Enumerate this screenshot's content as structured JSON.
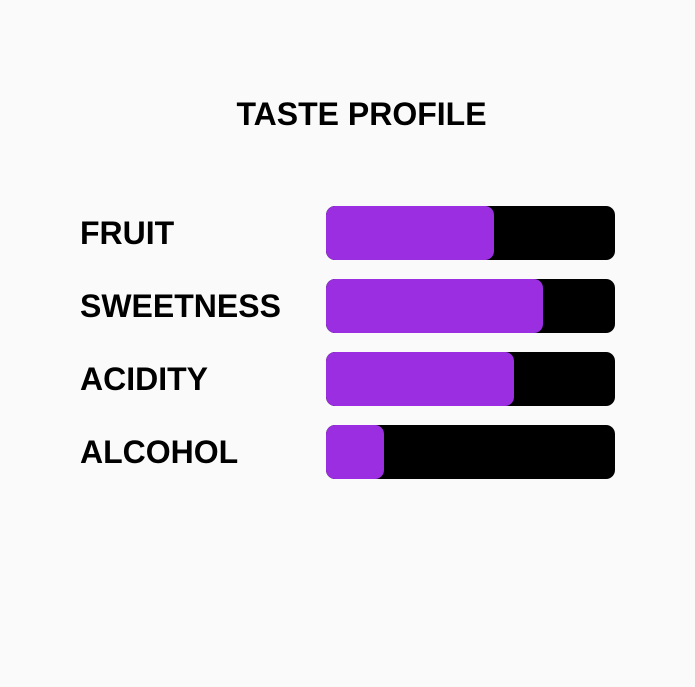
{
  "chart_data": {
    "type": "bar",
    "title": "TASTE PROFILE",
    "categories": [
      "FRUIT",
      "SWEETNESS",
      "ACIDITY",
      "ALCOHOL"
    ],
    "values": [
      0.58,
      0.75,
      0.65,
      0.2
    ],
    "xlim": [
      0,
      1
    ],
    "orientation": "horizontal",
    "colors": {
      "fill": "#9a2ee0",
      "track": "#000000",
      "background": "#fafafa"
    }
  }
}
